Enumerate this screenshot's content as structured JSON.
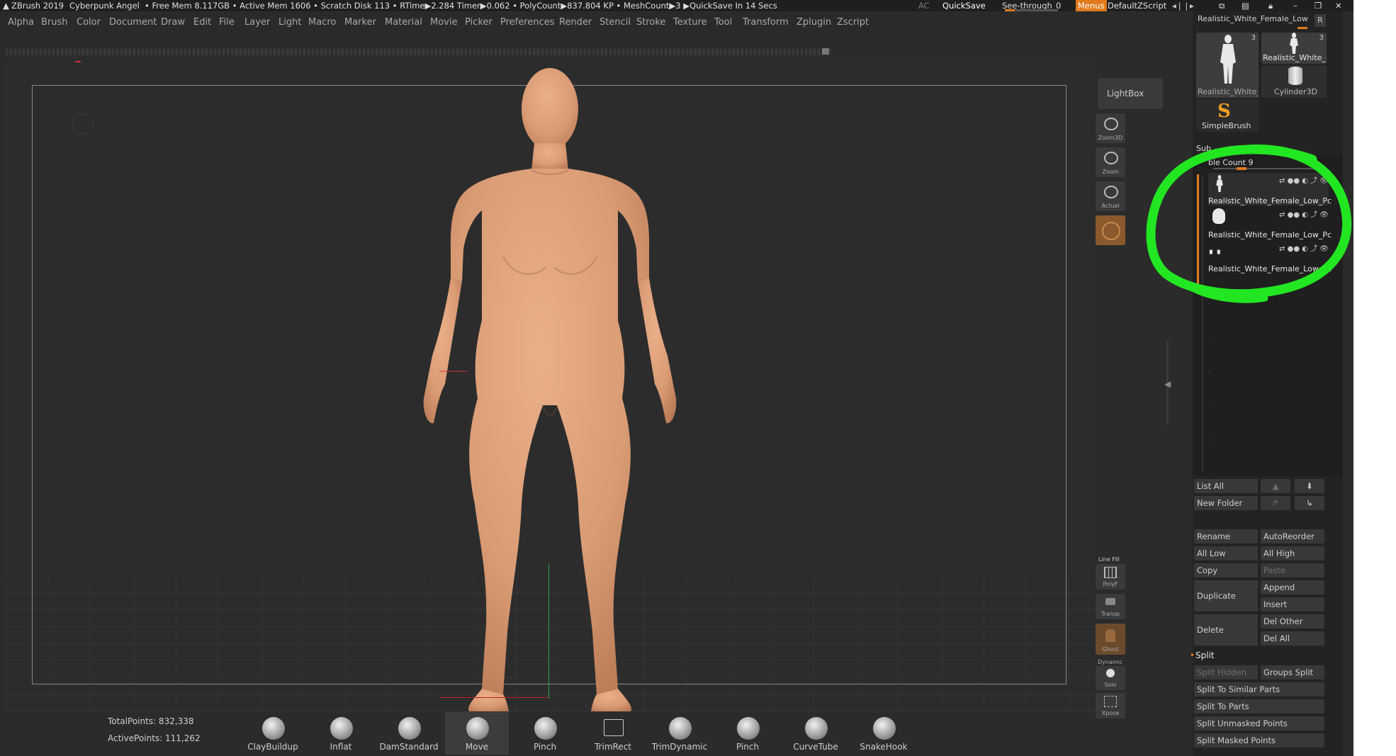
{
  "titlebar": {
    "app": "ZBrush 2019",
    "project": "Cyberpunk Angel",
    "stats": "• Free Mem 8.117GB • Active Mem 1606 • Scratch Disk 113 • RTime▶2.284 Timer▶0.062 • PolyCount▶837.804 KP • MeshCount▶3 ▶QuickSave In 14 Secs",
    "ac": "AC",
    "quicksave": "QuickSave",
    "see_through_label": "See-through",
    "see_through_value": "0",
    "menus": "Menus",
    "script": "DefaultZScript"
  },
  "menubar": [
    "Alpha",
    "Brush",
    "Color",
    "Document",
    "Draw",
    "Edit",
    "File",
    "Layer",
    "Light",
    "Macro",
    "Marker",
    "Material",
    "Movie",
    "Picker",
    "Preferences",
    "Render",
    "Stencil",
    "Stroke",
    "Texture",
    "Tool",
    "Transform",
    "Zplugin",
    "Zscript"
  ],
  "right_toolbar": {
    "lightbox": "LightBox",
    "zoom3d": "Zoom3D",
    "zoom": "Zoom",
    "actual": "Actual",
    "line_fill": "Line Fill",
    "polyf": "PolyF",
    "transp": "Transp",
    "ghost": "Ghost",
    "dynamic": "Dynamic",
    "solo": "Solo",
    "xpose": "Xpose"
  },
  "tool_panel": {
    "current_tool": "Realistic_White_Female_Low",
    "r_button": "R",
    "thumbs": [
      {
        "label": "Realistic_White_F",
        "count": "3"
      },
      {
        "label": "Realistic_White_F",
        "count": "3"
      },
      {
        "label": "Cylinder3D",
        "count": ""
      },
      {
        "label": "SimpleBrush",
        "count": ""
      }
    ]
  },
  "subtool": {
    "header": "Sub",
    "visible_count": "ble Count 9",
    "items": [
      {
        "name": "Realistic_White_Female_Low_Pc"
      },
      {
        "name": "Realistic_White_Female_Low_Pc"
      },
      {
        "name": "Realistic_White_Female_Low_Pc"
      }
    ],
    "buttons": {
      "list_all": "List All",
      "new_folder": "New Folder",
      "rename": "Rename",
      "autoreorder": "AutoReorder",
      "all_low": "All Low",
      "all_high": "All High",
      "copy": "Copy",
      "paste": "Paste",
      "duplicate": "Duplicate",
      "append": "Append",
      "insert": "Insert",
      "delete": "Delete",
      "del_other": "Del Other",
      "del_all": "Del All",
      "split": "Split",
      "split_hidden": "Split Hidden",
      "groups_split": "Groups Split",
      "split_similar": "Split To Similar Parts",
      "split_parts": "Split To Parts",
      "split_unmasked": "Split Unmasked Points",
      "split_masked": "Split Masked Points"
    }
  },
  "stats": {
    "total_points": "TotalPoints: 832,338",
    "active_points": "ActivePoints: 111,262"
  },
  "brushes": [
    "ClayBuildup",
    "Inflat",
    "DamStandard",
    "Move",
    "Pinch",
    "TrimRect",
    "TrimDynamic",
    "Pinch",
    "CurveTube",
    "SnakeHook"
  ],
  "colors": {
    "accent": "#e07a1d",
    "annotation": "#22e622",
    "skin": "#dba07a"
  }
}
